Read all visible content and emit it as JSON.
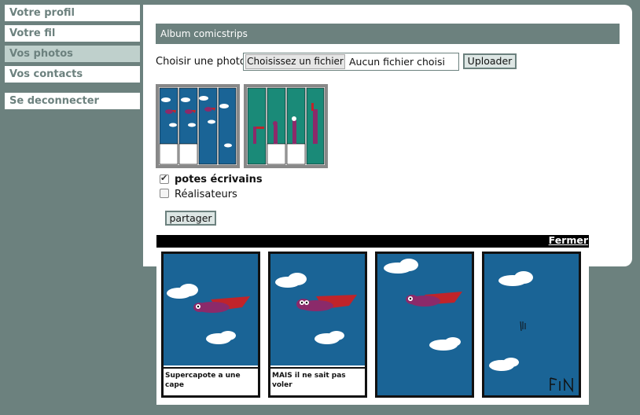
{
  "nav": {
    "items": [
      {
        "label": "Votre profil",
        "active": false
      },
      {
        "label": "Votre fil",
        "active": false
      },
      {
        "label": "Vos photos",
        "active": true
      },
      {
        "label": "Vos contacts",
        "active": false
      }
    ],
    "logout": "Se deconnecter"
  },
  "album": {
    "title": "Album comicstrips",
    "choose_label": "Choisir une photo",
    "file_button": "Choisissez un fichier",
    "file_status": "Aucun fichier choisi",
    "upload_button": "Uploader"
  },
  "share": {
    "groups": [
      {
        "label": "potes écrivains",
        "checked": true
      },
      {
        "label": "Réalisateurs",
        "checked": false
      }
    ],
    "button": "partager"
  },
  "viewer": {
    "close": "Fermer",
    "captions": [
      "Supercapote a une cape",
      "MAIS il ne sait pas voler",
      "",
      ""
    ]
  },
  "colors": {
    "background": "#6c817e",
    "active_nav": "#bfd0cc",
    "sky": "#1a6496",
    "hero": "#8b2a6a",
    "cape": "#c0242a"
  }
}
